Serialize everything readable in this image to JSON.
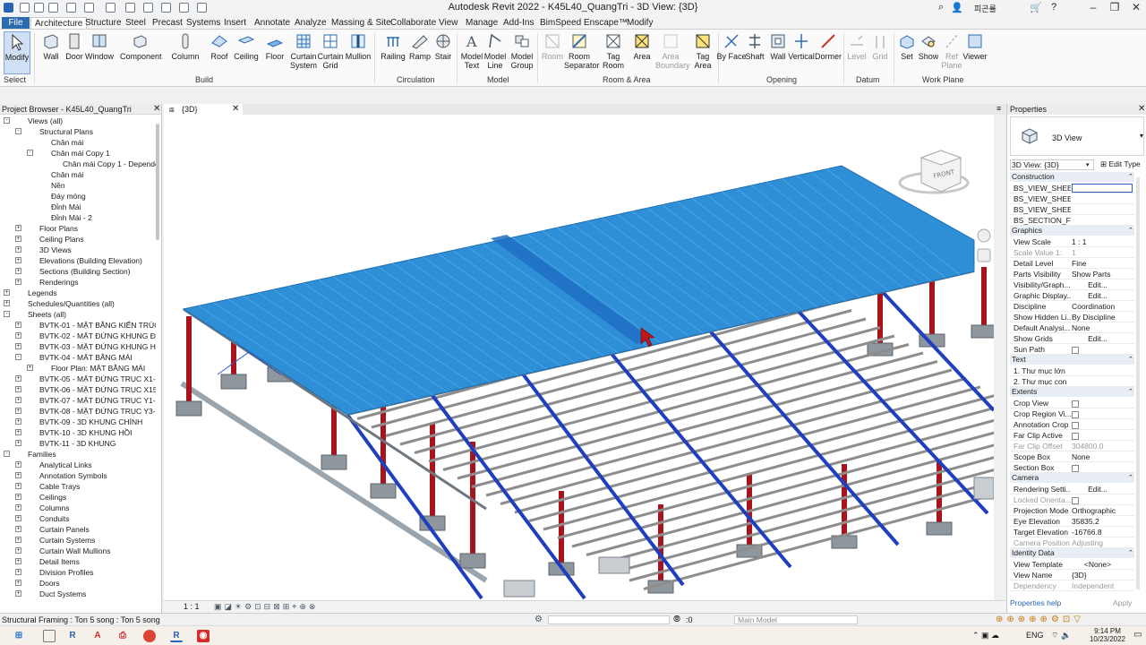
{
  "window": {
    "title": "Autodesk Revit 2022 - K45L40_QuangTri - 3D View: {3D}",
    "user": "피곤률"
  },
  "menu": {
    "file": "File",
    "tabs": [
      "Architecture",
      "Structure",
      "Steel",
      "Precast",
      "Systems",
      "Insert",
      "Annotate",
      "Analyze",
      "Massing & Site",
      "Collaborate",
      "View",
      "Manage",
      "Add-Ins",
      "BimSpeed",
      "Enscape™",
      "Modify"
    ]
  },
  "ribbon": {
    "select": {
      "modify": "Modify",
      "label": "Select"
    },
    "build": {
      "label": "Build",
      "buttons": [
        "Wall",
        "Door",
        "Window",
        "Component",
        "Column",
        "Roof",
        "Ceiling",
        "Floor",
        "Curtain System",
        "Curtain Grid",
        "Mullion"
      ]
    },
    "circulation": {
      "label": "Circulation",
      "buttons": [
        "Railing",
        "Ramp",
        "Stair"
      ]
    },
    "model": {
      "label": "Model",
      "buttons": [
        "Model Text",
        "Model Line",
        "Model Group"
      ]
    },
    "room_area": {
      "label": "Room & Area",
      "buttons": [
        "Room",
        "Room Separator",
        "Tag Room",
        "Area",
        "Area Boundary",
        "Tag Area"
      ]
    },
    "opening": {
      "label": "Opening",
      "buttons": [
        "By Face",
        "Shaft",
        "Wall",
        "Vertical",
        "Dormer"
      ]
    },
    "datum": {
      "label": "Datum",
      "buttons": [
        "Level",
        "Grid"
      ]
    },
    "work_plane": {
      "label": "Work Plane",
      "buttons": [
        "Set",
        "Show",
        "Ref Plane",
        "Viewer"
      ]
    }
  },
  "project_browser": {
    "title": "Project Browser - K45L40_QuangTri",
    "rows": [
      {
        "label": "Views (all)",
        "indent": 0,
        "toggle": "-"
      },
      {
        "label": "Structural Plans",
        "indent": 1,
        "toggle": "-"
      },
      {
        "label": "Chân mái",
        "indent": 2,
        "toggle": ""
      },
      {
        "label": "Chân mái Copy 1",
        "indent": 2,
        "toggle": "-"
      },
      {
        "label": "Chân mái Copy 1 - Dependent",
        "indent": 3,
        "toggle": ""
      },
      {
        "label": "Chân mái",
        "indent": 2,
        "toggle": ""
      },
      {
        "label": "Nền",
        "indent": 2,
        "toggle": ""
      },
      {
        "label": "Đáy móng",
        "indent": 2,
        "toggle": ""
      },
      {
        "label": "Đỉnh Mái",
        "indent": 2,
        "toggle": ""
      },
      {
        "label": "Đỉnh Mái - 2",
        "indent": 2,
        "toggle": ""
      },
      {
        "label": "Floor Plans",
        "indent": 1,
        "toggle": "+"
      },
      {
        "label": "Ceiling Plans",
        "indent": 1,
        "toggle": "+"
      },
      {
        "label": "3D Views",
        "indent": 1,
        "toggle": "+"
      },
      {
        "label": "Elevations (Building Elevation)",
        "indent": 1,
        "toggle": "+"
      },
      {
        "label": "Sections (Building Section)",
        "indent": 1,
        "toggle": "+"
      },
      {
        "label": "Renderings",
        "indent": 1,
        "toggle": "+"
      },
      {
        "label": "Legends",
        "indent": 0,
        "toggle": "+"
      },
      {
        "label": "Schedules/Quantities (all)",
        "indent": 0,
        "toggle": "+"
      },
      {
        "label": "Sheets (all)",
        "indent": 0,
        "toggle": "-"
      },
      {
        "label": "BVTK-01 - MẶT BẰNG KIẾN TRÚC TẦNG",
        "indent": 1,
        "toggle": "+"
      },
      {
        "label": "BVTK-02 - MẶT ĐỨNG KHUNG ĐIỂN HÌ",
        "indent": 1,
        "toggle": "+"
      },
      {
        "label": "BVTK-03 - MẶT ĐỨNG KHUNG HỒI",
        "indent": 1,
        "toggle": "+"
      },
      {
        "label": "BVTK-04 - MẶT BẰNG MÁI",
        "indent": 1,
        "toggle": "-"
      },
      {
        "label": "Floor Plan: MẶT BẰNG MÁI",
        "indent": 2,
        "toggle": "+"
      },
      {
        "label": "BVTK-05 - MẶT ĐỨNG TRỤC X1-X15",
        "indent": 1,
        "toggle": "+"
      },
      {
        "label": "BVTK-06 - MẶT ĐỨNG TRỤC X15-X1",
        "indent": 1,
        "toggle": "+"
      },
      {
        "label": "BVTK-07 - MẶT ĐỨNG TRỤC Y1-Y3",
        "indent": 1,
        "toggle": "+"
      },
      {
        "label": "BVTK-08 - MẶT ĐỨNG TRỤC Y3-Y1",
        "indent": 1,
        "toggle": "+"
      },
      {
        "label": "BVTK-09 - 3D KHUNG CHÍNH",
        "indent": 1,
        "toggle": "+"
      },
      {
        "label": "BVTK-10 - 3D KHUNG HỒI",
        "indent": 1,
        "toggle": "+"
      },
      {
        "label": "BVTK-11 - 3D KHUNG",
        "indent": 1,
        "toggle": "+"
      },
      {
        "label": "Families",
        "indent": 0,
        "toggle": "-"
      },
      {
        "label": "Analytical Links",
        "indent": 1,
        "toggle": "+"
      },
      {
        "label": "Annotation Symbols",
        "indent": 1,
        "toggle": "+"
      },
      {
        "label": "Cable Trays",
        "indent": 1,
        "toggle": "+"
      },
      {
        "label": "Ceilings",
        "indent": 1,
        "toggle": "+"
      },
      {
        "label": "Columns",
        "indent": 1,
        "toggle": "+"
      },
      {
        "label": "Conduits",
        "indent": 1,
        "toggle": "+"
      },
      {
        "label": "Curtain Panels",
        "indent": 1,
        "toggle": "+"
      },
      {
        "label": "Curtain Systems",
        "indent": 1,
        "toggle": "+"
      },
      {
        "label": "Curtain Wall Mullions",
        "indent": 1,
        "toggle": "+"
      },
      {
        "label": "Detail Items",
        "indent": 1,
        "toggle": "+"
      },
      {
        "label": "Division Profiles",
        "indent": 1,
        "toggle": "+"
      },
      {
        "label": "Doors",
        "indent": 1,
        "toggle": "+"
      },
      {
        "label": "Duct Systems",
        "indent": 1,
        "toggle": "+"
      }
    ]
  },
  "view": {
    "tab": "{3D}",
    "scale": "1 : 1",
    "viewcube_face": "FRONT"
  },
  "properties": {
    "title": "Properties",
    "type_name": "3D View",
    "instance_select": "3D View: {3D}",
    "edit_type": "Edit Type",
    "help": "Properties help",
    "apply": "Apply",
    "groups": [
      {
        "name": "Construction",
        "rows": [
          {
            "k": "BS_VIEW_SHEET...",
            "v": "",
            "kind": "input"
          },
          {
            "k": "BS_VIEW_SHEET...",
            "v": "",
            "kind": "text"
          },
          {
            "k": "BS_VIEW_SHEET...",
            "v": "",
            "kind": "text"
          },
          {
            "k": "BS_SECTION_FI...",
            "v": "",
            "kind": "text"
          }
        ]
      },
      {
        "name": "Graphics",
        "rows": [
          {
            "k": "View Scale",
            "v": "1 : 1",
            "kind": "text"
          },
          {
            "k": "Scale Value    1:",
            "v": "1",
            "kind": "grey"
          },
          {
            "k": "Detail Level",
            "v": "Fine",
            "kind": "text"
          },
          {
            "k": "Parts Visibility",
            "v": "Show Parts",
            "kind": "text"
          },
          {
            "k": "Visibility/Graph...",
            "v": "Edit...",
            "kind": "button"
          },
          {
            "k": "Graphic Display...",
            "v": "Edit...",
            "kind": "button"
          },
          {
            "k": "Discipline",
            "v": "Coordination",
            "kind": "text"
          },
          {
            "k": "Show Hidden Li...",
            "v": "By Discipline",
            "kind": "text"
          },
          {
            "k": "Default Analysi...",
            "v": "None",
            "kind": "text"
          },
          {
            "k": "Show Grids",
            "v": "Edit...",
            "kind": "button"
          },
          {
            "k": "Sun Path",
            "v": "",
            "kind": "check"
          }
        ]
      },
      {
        "name": "Text",
        "rows": [
          {
            "k": "1. Thư mục lớn",
            "v": "",
            "kind": "text"
          },
          {
            "k": "2. Thư mục con",
            "v": "",
            "kind": "text"
          }
        ]
      },
      {
        "name": "Extents",
        "rows": [
          {
            "k": "Crop View",
            "v": "",
            "kind": "check"
          },
          {
            "k": "Crop Region Vi...",
            "v": "",
            "kind": "check"
          },
          {
            "k": "Annotation Crop",
            "v": "",
            "kind": "check"
          },
          {
            "k": "Far Clip Active",
            "v": "",
            "kind": "check"
          },
          {
            "k": "Far Clip Offset",
            "v": "304800.0",
            "kind": "grey"
          },
          {
            "k": "Scope Box",
            "v": "None",
            "kind": "text"
          },
          {
            "k": "Section Box",
            "v": "",
            "kind": "check"
          }
        ]
      },
      {
        "name": "Camera",
        "rows": [
          {
            "k": "Rendering Setti...",
            "v": "Edit...",
            "kind": "button"
          },
          {
            "k": "Locked Orienta...",
            "v": "",
            "kind": "greycheck"
          },
          {
            "k": "Projection Mode",
            "v": "Orthographic",
            "kind": "text"
          },
          {
            "k": "Eye Elevation",
            "v": "35835.2",
            "kind": "text"
          },
          {
            "k": "Target Elevation",
            "v": "-16766.8",
            "kind": "text"
          },
          {
            "k": "Camera Position",
            "v": "Adjusting",
            "kind": "grey"
          }
        ]
      },
      {
        "name": "Identity Data",
        "rows": [
          {
            "k": "View Template",
            "v": "<None>",
            "kind": "button"
          },
          {
            "k": "View Name",
            "v": "{3D}",
            "kind": "text"
          },
          {
            "k": "Dependency",
            "v": "Independent",
            "kind": "grey"
          }
        ]
      }
    ]
  },
  "status": {
    "message": "Structural Framing : Ton 5 song : Ton 5 song",
    "selection_count": ":0",
    "model": "Main Model"
  },
  "taskbar": {
    "lang": "ENG",
    "time": "9:14 PM",
    "date": "10/23/2022"
  },
  "colors": {
    "roof": "#2e8fd6",
    "column": "#a8141c",
    "purlin": "#1f3fbf",
    "ribbon_accent": "#2b6cb0"
  }
}
